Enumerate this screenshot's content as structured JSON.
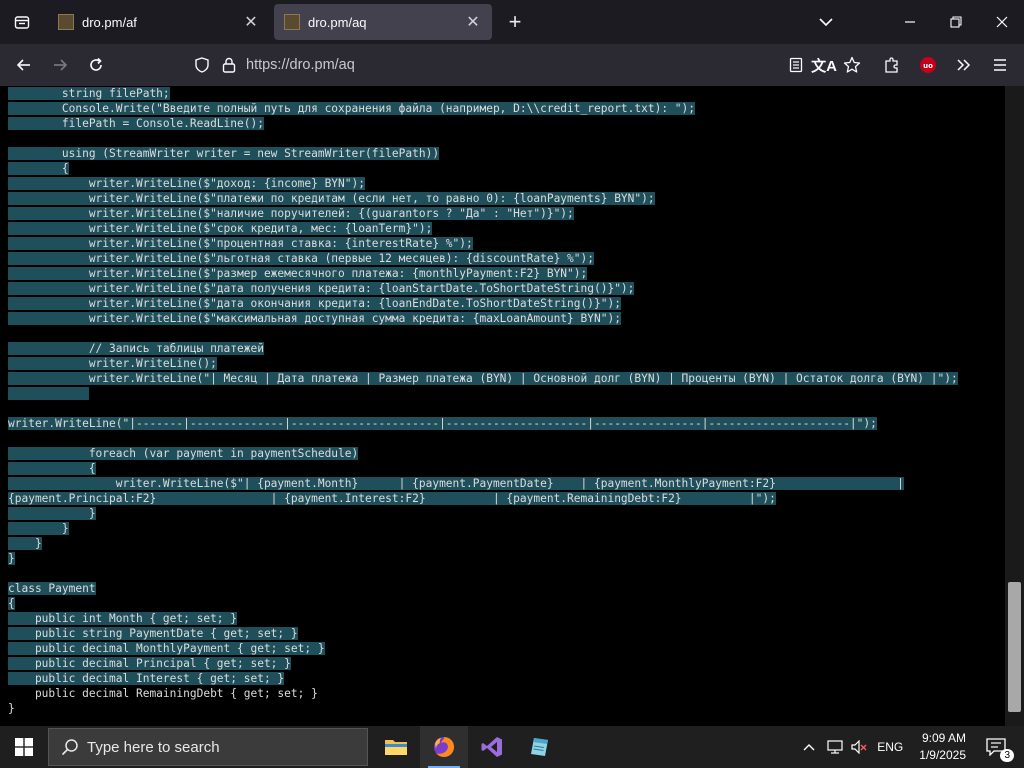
{
  "tabs": [
    {
      "title": "dro.pm/af",
      "active": false
    },
    {
      "title": "dro.pm/aq",
      "active": true
    }
  ],
  "navbar": {
    "url": "https://dro.pm/aq"
  },
  "code_lines": [
    {
      "text": "        string filePath;",
      "selected": true
    },
    {
      "text": "        Console.Write(\"Введите полный путь для сохранения файла (например, D:\\\\credit_report.txt): \");",
      "selected": true
    },
    {
      "text": "        filePath = Console.ReadLine();",
      "selected": true
    },
    {
      "text": "",
      "selected": true
    },
    {
      "text": "        using (StreamWriter writer = new StreamWriter(filePath))",
      "selected": true
    },
    {
      "text": "        {",
      "selected": true
    },
    {
      "text": "            writer.WriteLine($\"доход: {income} BYN\");",
      "selected": true
    },
    {
      "text": "            writer.WriteLine($\"платежи по кредитам (если нет, то равно 0): {loanPayments} BYN\");",
      "selected": true
    },
    {
      "text": "            writer.WriteLine($\"наличие поручителей: {(guarantors ? \"Да\" : \"Нет\")}\");",
      "selected": true
    },
    {
      "text": "            writer.WriteLine($\"срок кредита, мес: {loanTerm}\");",
      "selected": true
    },
    {
      "text": "            writer.WriteLine($\"процентная ставка: {interestRate} %\");",
      "selected": true
    },
    {
      "text": "            writer.WriteLine($\"льготная ставка (первые 12 месяцев): {discountRate} %\");",
      "selected": true
    },
    {
      "text": "            writer.WriteLine($\"размер ежемесячного платежа: {monthlyPayment:F2} BYN\");",
      "selected": true
    },
    {
      "text": "            writer.WriteLine($\"дата получения кредита: {loanStartDate.ToShortDateString()}\");",
      "selected": true
    },
    {
      "text": "            writer.WriteLine($\"дата окончания кредита: {loanEndDate.ToShortDateString()}\");",
      "selected": true
    },
    {
      "text": "            writer.WriteLine($\"максимальная доступная сумма кредита: {maxLoanAmount} BYN\");",
      "selected": true
    },
    {
      "text": "",
      "selected": true
    },
    {
      "text": "            // Запись таблицы платежей",
      "selected": true
    },
    {
      "text": "            writer.WriteLine();",
      "selected": true
    },
    {
      "text": "            writer.WriteLine(\"| Месяц | Дата платежа | Размер платежа (BYN) | Основной долг (BYN) | Проценты (BYN) | Остаток долга (BYN) |\");",
      "selected": true
    },
    {
      "text": "            ",
      "selected": true
    },
    {
      "text": "",
      "selected": false
    },
    {
      "text": "writer.WriteLine(\"|-------|--------------|----------------------|---------------------|----------------|---------------------|\");",
      "selected": true
    },
    {
      "text": "",
      "selected": false
    },
    {
      "text": "            foreach (var payment in paymentSchedule)",
      "selected": true
    },
    {
      "text": "            {",
      "selected": true
    },
    {
      "text": "                writer.WriteLine($\"| {payment.Month}      | {payment.PaymentDate}    | {payment.MonthlyPayment:F2}                  |",
      "selected": true
    },
    {
      "text": "{payment.Principal:F2}                 | {payment.Interest:F2}          | {payment.RemainingDebt:F2}          |\");",
      "selected": true
    },
    {
      "text": "            }",
      "selected": true
    },
    {
      "text": "        }",
      "selected": true
    },
    {
      "text": "    }",
      "selected": true
    },
    {
      "text": "}",
      "selected": true
    },
    {
      "text": "",
      "selected": false
    },
    {
      "text": "class Payment",
      "selected": true
    },
    {
      "text": "{",
      "selected": true
    },
    {
      "text": "    public int Month { get; set; }",
      "selected": true
    },
    {
      "text": "    public string PaymentDate { get; set; }",
      "selected": true
    },
    {
      "text": "    public decimal MonthlyPayment { get; set; }",
      "selected": true
    },
    {
      "text": "    public decimal Principal { get; set; }",
      "selected": true
    },
    {
      "text": "    public decimal Interest { get; set; }",
      "selected": true
    },
    {
      "text": "    public decimal RemainingDebt { get; set; }",
      "selected": false
    },
    {
      "text": "}",
      "selected": false
    }
  ],
  "taskbar": {
    "search_placeholder": "Type here to search",
    "language": "ENG",
    "time": "9:09 AM",
    "date": "1/9/2025",
    "notification_count": "3"
  },
  "colors": {
    "selection": "#1e4f5b",
    "tab_active": "#42414d",
    "navbar": "#2b2a33",
    "taskbar": "#1f1f1f"
  }
}
